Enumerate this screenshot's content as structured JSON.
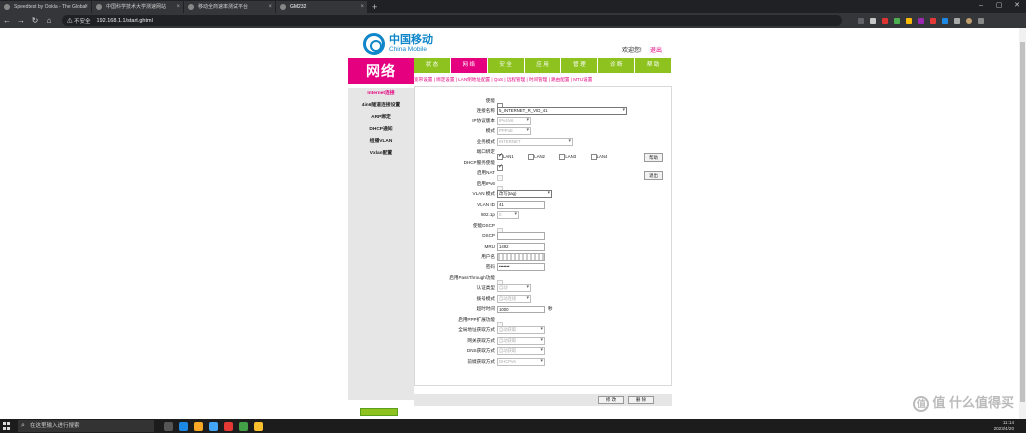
{
  "browser": {
    "tabs": [
      {
        "label": "Speedtest by Ookla - The Global",
        "active": false
      },
      {
        "label": "中国科学技术大学测速网站",
        "active": false
      },
      {
        "label": "移动全商速率测试平台",
        "active": false
      },
      {
        "label": "GM232",
        "active": true
      }
    ],
    "security_label": "不安全",
    "url": "192.168.1.1/start.ghtml"
  },
  "header": {
    "logo_cn": "中国移动",
    "logo_en": "China Mobile",
    "welcome": "欢迎您!",
    "logout": "退出"
  },
  "section_title": "网络",
  "main_nav": [
    {
      "label": "状 态",
      "active": false
    },
    {
      "label": "网 络",
      "active": true
    },
    {
      "label": "安 全",
      "active": false
    },
    {
      "label": "应 用",
      "active": false
    },
    {
      "label": "管 理",
      "active": false
    },
    {
      "label": "诊 断",
      "active": false
    },
    {
      "label": "帮 助",
      "active": false
    }
  ],
  "sub_nav": "宽带设置 | 绑定设置 | LAN侧地址配置 | QoS | 远程管理 | 时间管理 | 路由配置 | MTU设置",
  "sidebar": [
    {
      "label": "Internet连接",
      "active": true
    },
    {
      "label": "4in6隧道连接设置",
      "active": false
    },
    {
      "label": "ARP绑定",
      "active": false
    },
    {
      "label": "DHCP通知",
      "active": false
    },
    {
      "label": "组播VLAN",
      "active": false
    },
    {
      "label": "Vxlan配置",
      "active": false
    }
  ],
  "form": {
    "enable_label": "使能",
    "conn_name_label": "连接名称",
    "conn_name_value": "5_INTERNET_R_VID_41",
    "ip_proto_label": "IP协议版本",
    "ip_proto_value": "IPv4/v6",
    "mode_label": "模式",
    "mode_value": "PPPoE",
    "service_label": "业务模式",
    "service_value": "INTERNET",
    "port_label": "端口绑定",
    "ports": [
      "LAN1",
      "LAN2",
      "LAN3",
      "LAN4"
    ],
    "dhcp_server_label": "DHCP服务使能",
    "nat_label": "启用NAT",
    "ipv6_label": "启用IPv6",
    "vlan_mode_label": "VLAN 模式",
    "vlan_mode_value": "改写(tag)",
    "vlan_id_label": "VLAN ID",
    "vlan_id_value": "41",
    "dot1p_label": "802.1p",
    "dot1p_value": "0",
    "dscp_enable_label": "使能DSCP",
    "dscp_label": "DSCP",
    "mru_label": "MRU",
    "mru_value": "1492",
    "username_label": "用户名",
    "username_value": "",
    "password_label": "密码",
    "password_value": "•••••••",
    "passthrough_label": "启用PassThrough功能",
    "auth_label": "认证类型",
    "auth_value": "自动",
    "dial_label": "拨号模式",
    "dial_value": "自动连接",
    "idle_label": "超时时间",
    "idle_value": "1000",
    "idle_unit": "秒",
    "pppproxy_label": "启用PPP扩展功能",
    "global_addr_label": "全局地址获取方式",
    "global_addr_value": "自动获取",
    "gateway_label": "网关获取方式",
    "gateway_value": "自动获取",
    "dns_label": "DNS获取方式",
    "dns_value": "自动获取",
    "prefix_label": "前缀获取方式",
    "prefix_value": "DHCPv6"
  },
  "side_buttons": {
    "help": "帮助",
    "exit": "退出"
  },
  "bottom_buttons": {
    "modify": "修 改",
    "delete": "删 除"
  },
  "taskbar": {
    "search_placeholder": "在这里输入进行搜索",
    "time": "11:14",
    "date": "2023/4/20"
  },
  "watermark": "值 什么值得买"
}
